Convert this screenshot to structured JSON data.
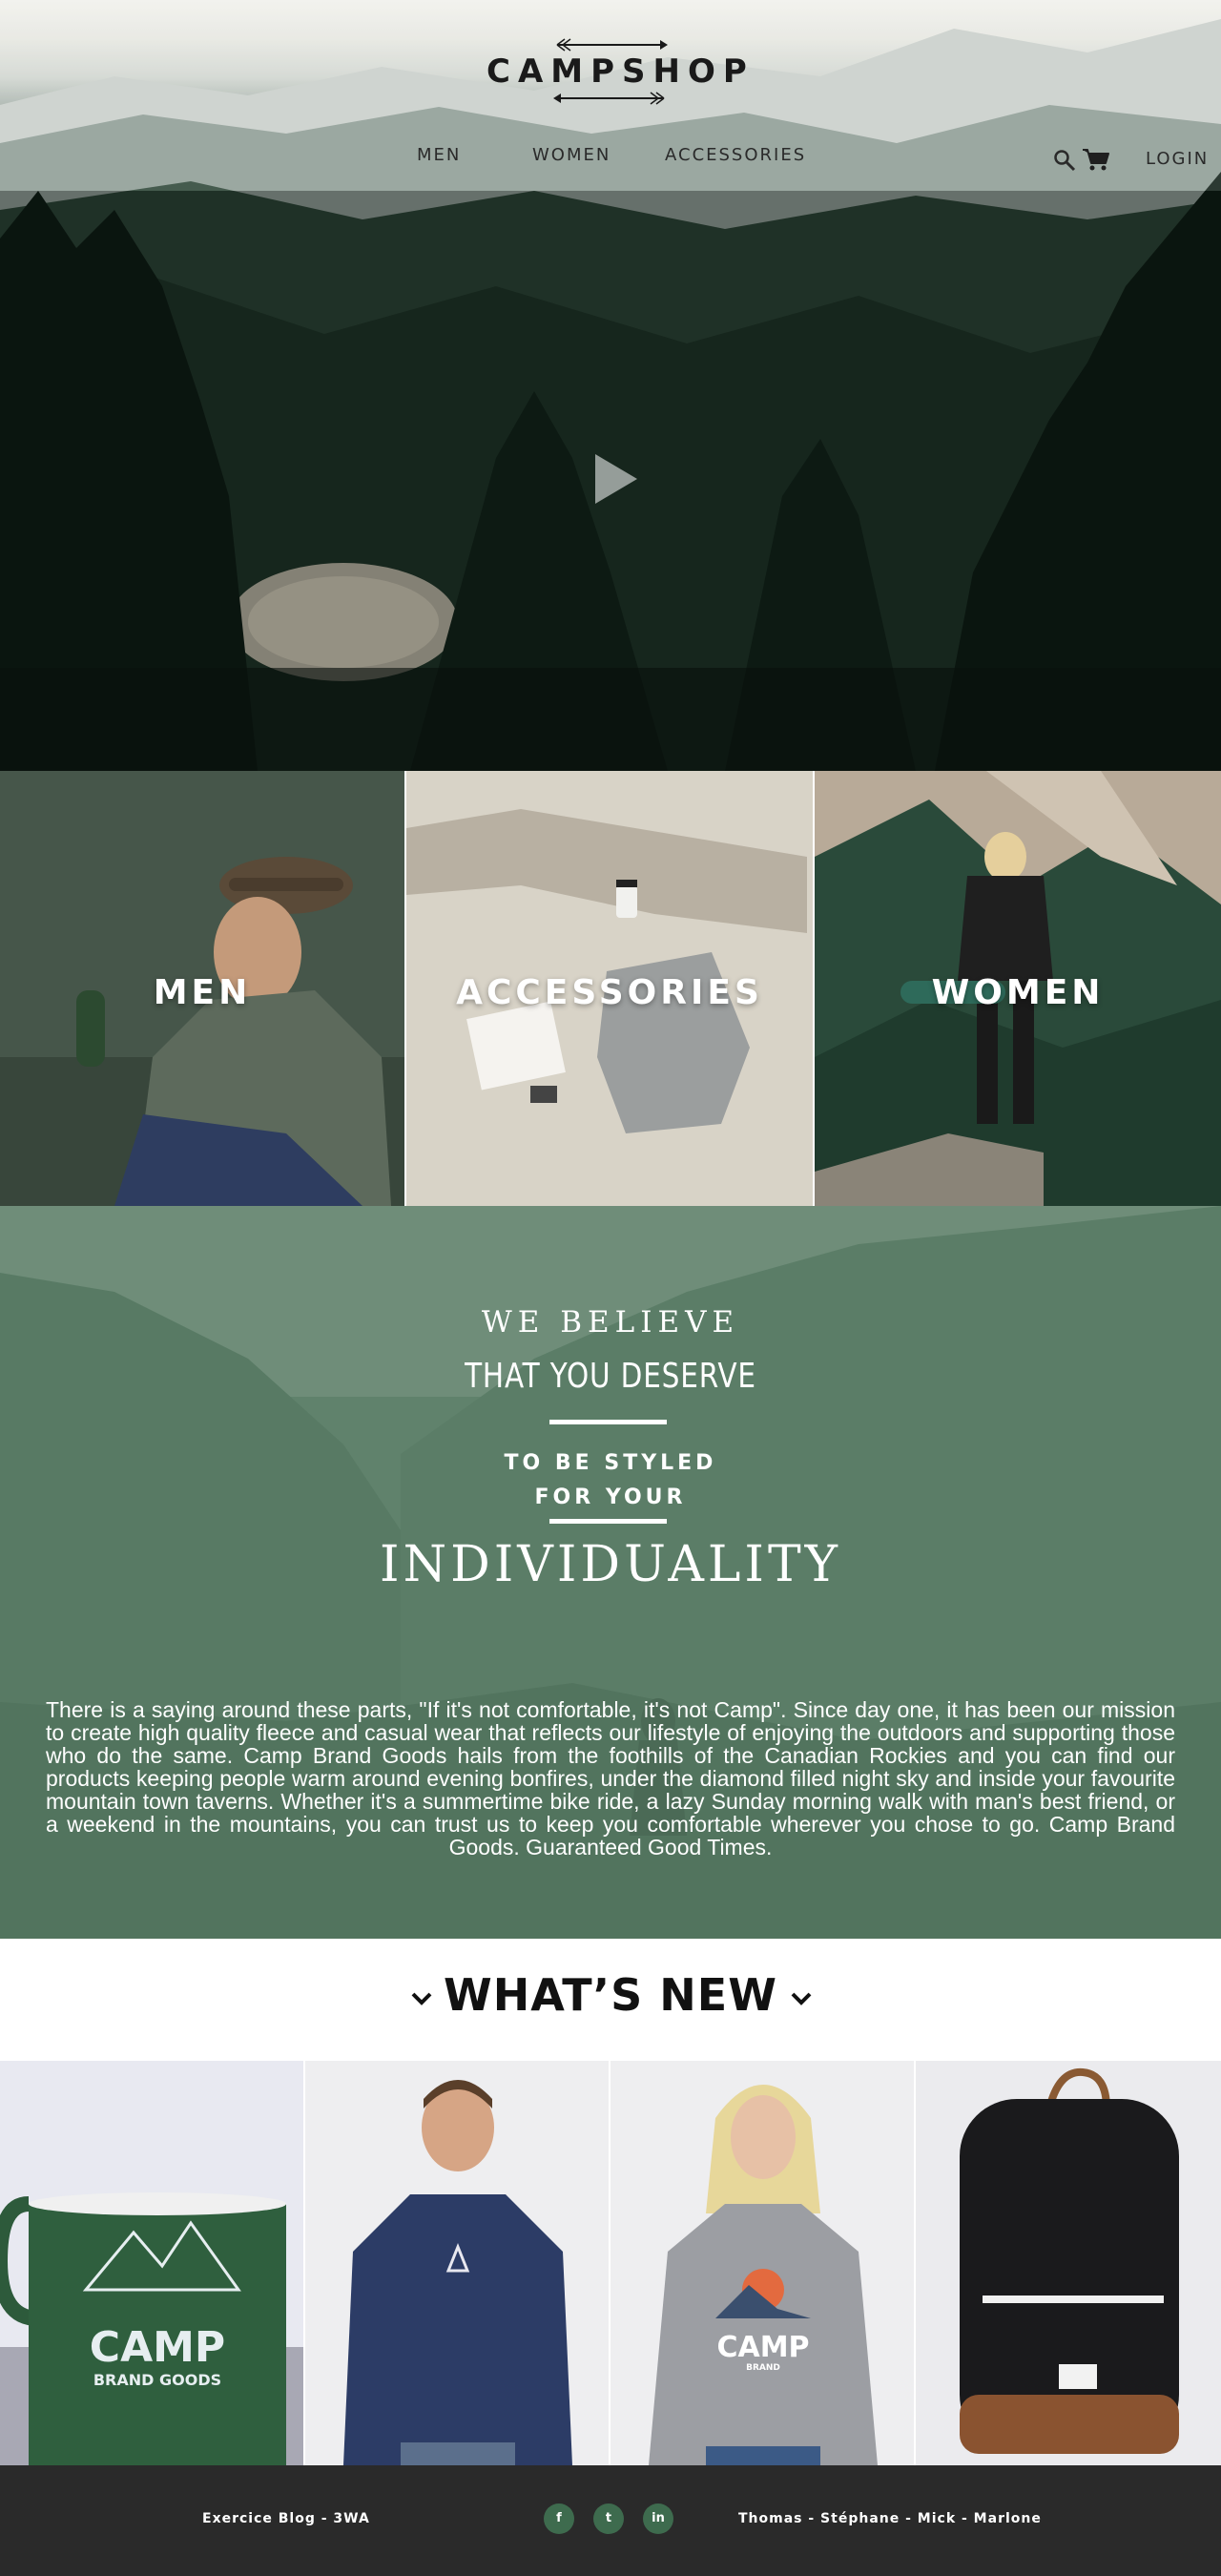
{
  "header": {
    "logo": "CAMPSHOP",
    "nav": [
      "MEN",
      "WOMEN",
      "ACCESSORIES"
    ],
    "login": "LOGIN",
    "icons": [
      "search-icon",
      "cart-icon"
    ]
  },
  "hero": {
    "video_control": "play-icon"
  },
  "categories": [
    {
      "label": "MEN"
    },
    {
      "label": "ACCESSORIES"
    },
    {
      "label": "WOMEN"
    }
  ],
  "believe": {
    "line1": "WE BELIEVE",
    "line2": "THAT YOU DESERVE",
    "line3a": "TO BE STYLED",
    "line3b": "FOR YOUR",
    "line4": "INDIVIDUALITY",
    "paragraph": "There is a saying around these parts, \"If it's not comfortable, it's not Camp\". Since day one, it has been our mission to create high quality fleece and casual wear that reflects our lifestyle of enjoying the outdoors and supporting those who do the same. Camp Brand Goods hails from the foothills of the Canadian Rockies and you can find our products keeping people warm around evening bonfires, under the diamond filled night sky and inside your favourite mountain town taverns. Whether it's a summertime bike ride, a lazy Sunday morning walk with man's best friend, or a weekend in the mountains, you can trust us to keep you comfortable wherever you chose to go. Camp Brand Goods. Guaranteed Good Times."
  },
  "whats_new": {
    "title": "WHAT’S NEW",
    "products": [
      {
        "print_line1": "CAMP",
        "print_line2": "BRAND GOODS"
      },
      {
        "print_line1": ""
      },
      {
        "print_line1": "CAMP",
        "print_line2": "BRAND"
      },
      {
        "print_line1": ""
      }
    ]
  },
  "footer": {
    "left": "Exercice Blog - 3WA",
    "right": "Thomas - Stéphane - Mick - Marlone",
    "social": [
      "f",
      "t",
      "in"
    ]
  },
  "colors": {
    "accent_green": "#3e6b4e",
    "footer_bg": "#2a2a2a",
    "believe_overlay": "#5e7d69"
  }
}
